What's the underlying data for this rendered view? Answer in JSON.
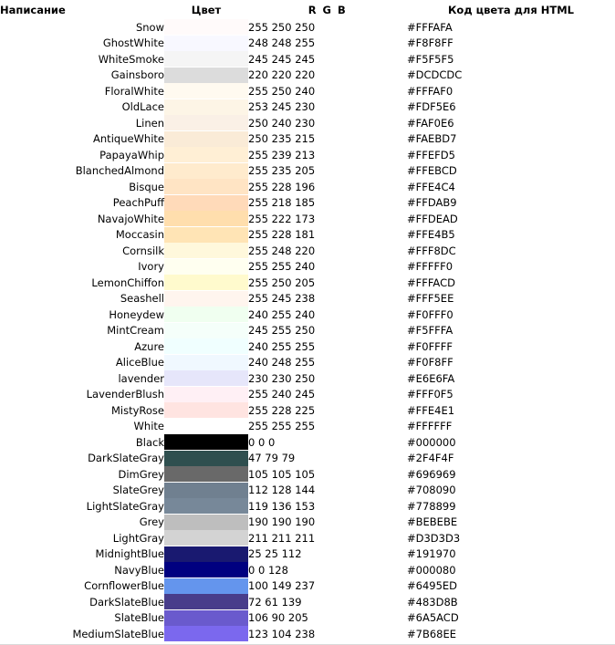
{
  "table": {
    "headers": {
      "name": "Написание",
      "color": "Цвет",
      "rgb": "R G B",
      "hex": "Код цвета для HTML"
    },
    "rows": [
      {
        "name": "Snow",
        "rgb": "255 250 250",
        "hex": "#FFFAFA"
      },
      {
        "name": "GhostWhite",
        "rgb": "248 248 255",
        "hex": "#F8F8FF"
      },
      {
        "name": "WhiteSmoke",
        "rgb": "245 245 245",
        "hex": "#F5F5F5"
      },
      {
        "name": "Gainsboro",
        "rgb": "220 220 220",
        "hex": "#DCDCDC"
      },
      {
        "name": "FloralWhite",
        "rgb": "255 250 240",
        "hex": "#FFFAF0"
      },
      {
        "name": "OldLace",
        "rgb": "253 245 230",
        "hex": "#FDF5E6"
      },
      {
        "name": "Linen",
        "rgb": "250 240 230",
        "hex": "#FAF0E6"
      },
      {
        "name": "AntiqueWhite",
        "rgb": "250 235 215",
        "hex": "#FAEBD7"
      },
      {
        "name": "PapayaWhip",
        "rgb": "255 239 213",
        "hex": "#FFEFD5"
      },
      {
        "name": "BlanchedAlmond",
        "rgb": "255 235 205",
        "hex": "#FFEBCD"
      },
      {
        "name": "Bisque",
        "rgb": "255 228 196",
        "hex": "#FFE4C4"
      },
      {
        "name": "PeachPuff",
        "rgb": "255 218 185",
        "hex": "#FFDAB9"
      },
      {
        "name": "NavajoWhite",
        "rgb": "255 222 173",
        "hex": "#FFDEAD"
      },
      {
        "name": "Moccasin",
        "rgb": "255 228 181",
        "hex": "#FFE4B5"
      },
      {
        "name": "Cornsilk",
        "rgb": "255 248 220",
        "hex": "#FFF8DC"
      },
      {
        "name": "Ivory",
        "rgb": "255 255 240",
        "hex": "#FFFFF0"
      },
      {
        "name": "LemonChiffon",
        "rgb": "255 250 205",
        "hex": "#FFFACD"
      },
      {
        "name": "Seashell",
        "rgb": "255 245 238",
        "hex": "#FFF5EE"
      },
      {
        "name": "Honeydew",
        "rgb": "240 255 240",
        "hex": "#F0FFF0"
      },
      {
        "name": "MintCream",
        "rgb": "245 255 250",
        "hex": "#F5FFFA"
      },
      {
        "name": "Azure",
        "rgb": "240 255 255",
        "hex": "#F0FFFF"
      },
      {
        "name": "AliceBlue",
        "rgb": "240 248 255",
        "hex": "#F0F8FF"
      },
      {
        "name": "lavender",
        "rgb": "230 230 250",
        "hex": "#E6E6FA"
      },
      {
        "name": "LavenderBlush",
        "rgb": "255 240 245",
        "hex": "#FFF0F5"
      },
      {
        "name": "MistyRose",
        "rgb": "255 228 225",
        "hex": "#FFE4E1"
      },
      {
        "name": "White",
        "rgb": "255 255 255",
        "hex": "#FFFFFF"
      },
      {
        "name": "Black",
        "rgb": "0 0 0",
        "hex": "#000000"
      },
      {
        "name": "DarkSlateGray",
        "rgb": "47 79 79",
        "hex": "#2F4F4F"
      },
      {
        "name": "DimGrey",
        "rgb": "105 105 105",
        "hex": "#696969"
      },
      {
        "name": "SlateGrey",
        "rgb": "112 128 144",
        "hex": "#708090"
      },
      {
        "name": "LightSlateGray",
        "rgb": "119 136 153",
        "hex": "#778899"
      },
      {
        "name": "Grey",
        "rgb": "190 190 190",
        "hex": "#BEBEBE"
      },
      {
        "name": "LightGray",
        "rgb": "211 211 211",
        "hex": "#D3D3D3"
      },
      {
        "name": "MidnightBlue",
        "rgb": "25 25 112",
        "hex": "#191970"
      },
      {
        "name": "NavyBlue",
        "rgb": "0 0 128",
        "hex": "#000080"
      },
      {
        "name": "CornflowerBlue",
        "rgb": "100 149 237",
        "hex": "#6495ED"
      },
      {
        "name": "DarkSlateBlue",
        "rgb": "72 61 139",
        "hex": "#483D8B"
      },
      {
        "name": "SlateBlue",
        "rgb": "106 90 205",
        "hex": "#6A5ACD"
      },
      {
        "name": "MediumSlateBlue",
        "rgb": "123 104 238",
        "hex": "#7B68EE"
      }
    ]
  }
}
